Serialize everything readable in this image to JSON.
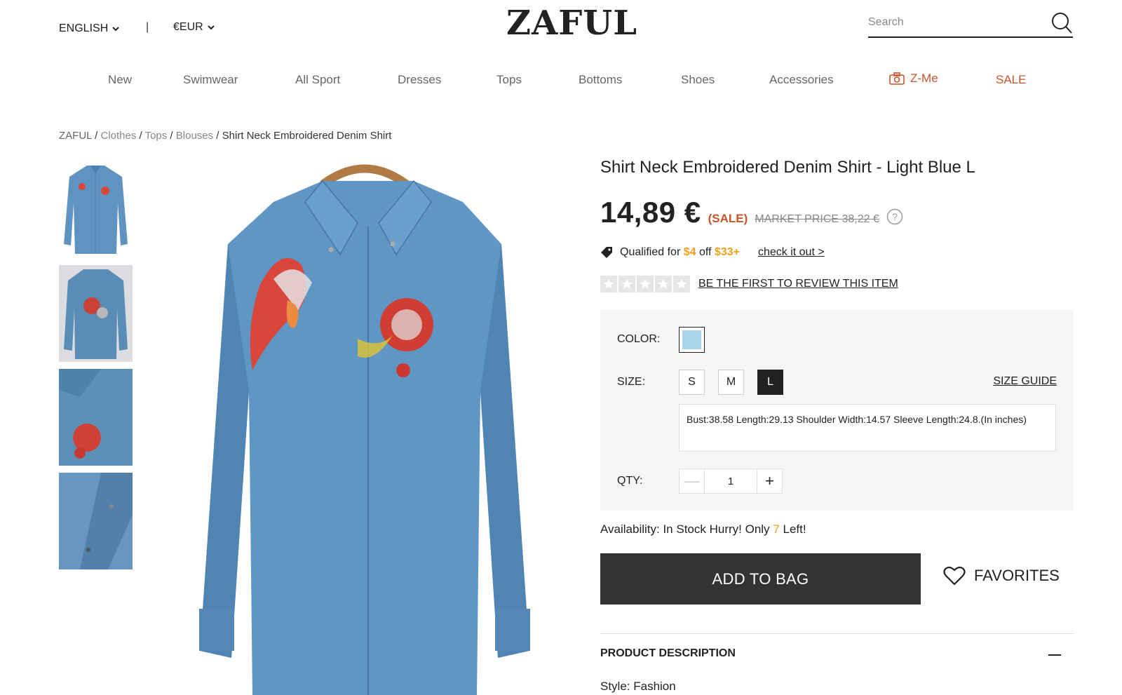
{
  "header": {
    "language": "ENGLISH",
    "separator": "|",
    "currency": "€EUR",
    "logo": "ZAFUL",
    "search_placeholder": "Search"
  },
  "nav": {
    "items": [
      "New",
      "Swimwear",
      "All Sport",
      "Dresses",
      "Tops",
      "Bottoms",
      "Shoes",
      "Accessories"
    ],
    "zme": "Z-Me",
    "sale": "SALE"
  },
  "breadcrumb": {
    "home": "ZAFUL",
    "sep": " / ",
    "c1": "Clothes",
    "c2": "Tops",
    "c3": "Blouses",
    "current": "Shirt Neck Embroidered Denim Shirt"
  },
  "product": {
    "title": "Shirt Neck Embroidered Denim Shirt - Light Blue L",
    "price": "14,89 €",
    "sale_tag": "(SALE)",
    "market_price": "MARKET PRICE 38,22 €",
    "promo_prefix": "Qualified for",
    "promo_amount": "$4",
    "promo_off": "off",
    "promo_threshold": "$33+",
    "promo_link": "check it out >",
    "review_link": "BE THE FIRST TO REVIEW THIS ITEM",
    "rating": 0,
    "rating_max": 5
  },
  "options": {
    "color_label": "COLOR:",
    "color_swatch": "#a8d4ec",
    "size_label": "SIZE:",
    "sizes": [
      "S",
      "M",
      "L"
    ],
    "selected_size": "L",
    "size_guide": "SIZE GUIDE",
    "measurements": "Bust:38.58   Length:29.13   Shoulder Width:14.57   Sleeve Length:24.8.(In inches)",
    "qty_label": "QTY:",
    "qty_value": "1",
    "qty_minus": "—",
    "qty_plus": "+"
  },
  "availability": {
    "prefix": "Availability: In Stock Hurry! Only",
    "count": "7",
    "suffix": "Left!"
  },
  "actions": {
    "add_to_bag": "ADD TO BAG",
    "favorites": "FAVORITES"
  },
  "description": {
    "heading": "PRODUCT DESCRIPTION",
    "style": "Style: Fashion"
  },
  "colors": {
    "accent": "#c8552b",
    "promo": "#f0a01a",
    "denim": "#5f93c0"
  }
}
